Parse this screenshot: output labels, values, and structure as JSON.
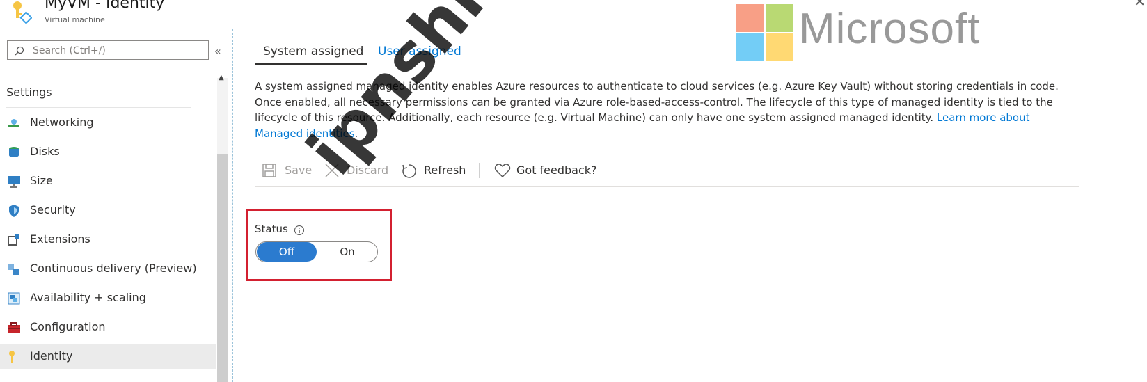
{
  "header": {
    "title": "MyVM - Identity",
    "subtitle": "Virtual machine"
  },
  "sidebar": {
    "search_placeholder": "Search (Ctrl+/)",
    "section_label": "Settings",
    "items": [
      {
        "label": "Networking",
        "icon": "networking-icon"
      },
      {
        "label": "Disks",
        "icon": "disks-icon"
      },
      {
        "label": "Size",
        "icon": "size-icon"
      },
      {
        "label": "Security",
        "icon": "security-icon"
      },
      {
        "label": "Extensions",
        "icon": "extensions-icon"
      },
      {
        "label": "Continuous delivery (Preview)",
        "icon": "continuous-delivery-icon"
      },
      {
        "label": "Availability + scaling",
        "icon": "availability-icon"
      },
      {
        "label": "Configuration",
        "icon": "configuration-icon"
      },
      {
        "label": "Identity",
        "icon": "identity-icon",
        "active": true
      }
    ]
  },
  "main": {
    "tabs": [
      {
        "label": "System assigned",
        "selected": true
      },
      {
        "label": "User assigned",
        "selected": false
      }
    ],
    "description": "A system assigned managed identity enables Azure resources to authenticate to cloud services (e.g. Azure Key Vault) without storing credentials in code. Once enabled, all necessary permissions can be granted via Azure role-based-access-control. The lifecycle of this type of managed identity is tied to the lifecycle of this resource. Additionally, each resource (e.g. Virtual Machine) can only have one system assigned managed identity.",
    "learn_more_link": "Learn more about Managed identities",
    "learn_more_suffix": ".",
    "toolbar": {
      "save": "Save",
      "discard": "Discard",
      "refresh": "Refresh",
      "feedback": "Got feedback?"
    },
    "status": {
      "label": "Status",
      "options": [
        "Off",
        "On"
      ],
      "selected": "Off"
    }
  },
  "watermarks": {
    "site": "ipnshiken.com",
    "brand": "Microsoft"
  },
  "colors": {
    "accent": "#0078d4",
    "toggle_selected": "#2b7bcf",
    "highlight_box": "#d32030"
  }
}
